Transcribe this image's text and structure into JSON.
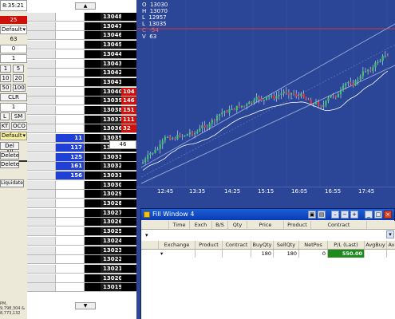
{
  "left_panel": {
    "clock": "8:35:21",
    "badge_value": "25",
    "default_select_1": "Default",
    "qty_label": "63",
    "field_a": "0",
    "field_b": "1",
    "qty_buttons": [
      "1",
      "5",
      "10",
      "20",
      "50",
      "100"
    ],
    "clr_label": "CLR",
    "field_c": "1",
    "lm_buttons": [
      "L",
      "SM"
    ],
    "kt_buttons": [
      "KT",
      "OCO"
    ],
    "default_select_2": "Default",
    "del_all_label": "Del All",
    "delete_label_1": "Delete",
    "delete_label_2": "Delete",
    "liquidate_label": "Liquidate",
    "footnote_line1": "PM, 9,798,304 &",
    "footnote_line2": "8,773,132"
  },
  "ladder": {
    "scroll_up": "▲",
    "scroll_down": "▼",
    "position_value": "46",
    "rows": [
      {
        "price": "13048",
        "bid": "",
        "ask": ""
      },
      {
        "price": "13047",
        "bid": "",
        "ask": ""
      },
      {
        "price": "13046",
        "bid": "",
        "ask": ""
      },
      {
        "price": "13045",
        "bid": "",
        "ask": ""
      },
      {
        "price": "13044",
        "bid": "",
        "ask": ""
      },
      {
        "price": "13043",
        "bid": "",
        "ask": ""
      },
      {
        "price": "13042",
        "bid": "",
        "ask": ""
      },
      {
        "price": "13041",
        "bid": "",
        "ask": ""
      },
      {
        "price": "13040",
        "bid": "",
        "ask": "104"
      },
      {
        "price": "13039",
        "bid": "",
        "ask": "146"
      },
      {
        "price": "13038",
        "bid": "",
        "ask": "151"
      },
      {
        "price": "13037",
        "bid": "",
        "ask": "111"
      },
      {
        "price": "13036",
        "bid": "",
        "ask": "32"
      },
      {
        "price": "13035",
        "bid": "11",
        "ask": ""
      },
      {
        "price": "13034",
        "bid": "117",
        "ask": ""
      },
      {
        "price": "13033",
        "bid": "125",
        "ask": ""
      },
      {
        "price": "13032",
        "bid": "161",
        "ask": ""
      },
      {
        "price": "13031",
        "bid": "156",
        "ask": ""
      },
      {
        "price": "13030",
        "bid": "",
        "ask": ""
      },
      {
        "price": "13029",
        "bid": "",
        "ask": ""
      },
      {
        "price": "13028",
        "bid": "",
        "ask": ""
      },
      {
        "price": "13027",
        "bid": "",
        "ask": ""
      },
      {
        "price": "13026",
        "bid": "",
        "ask": ""
      },
      {
        "price": "13025",
        "bid": "",
        "ask": ""
      },
      {
        "price": "13024",
        "bid": "",
        "ask": ""
      },
      {
        "price": "13023",
        "bid": "",
        "ask": ""
      },
      {
        "price": "13022",
        "bid": "",
        "ask": ""
      },
      {
        "price": "13021",
        "bid": "",
        "ask": ""
      },
      {
        "price": "13020",
        "bid": "",
        "ask": ""
      },
      {
        "price": "13019",
        "bid": "",
        "ask": ""
      }
    ]
  },
  "chart": {
    "ohlc": {
      "o_label": "O",
      "o": "13030",
      "h_label": "H",
      "h": "13070",
      "l_label": "L",
      "l": "12957",
      "last_label": "L",
      "last": "13035",
      "c_label": "C",
      "c": "-54",
      "v_label": "V",
      "v": "63"
    },
    "time_labels": [
      "12:45",
      "13:35",
      "14:25",
      "15:15",
      "16:05",
      "16:55",
      "17:45"
    ],
    "colors": {
      "background": "#2b4696",
      "up_candle": "#3fc46b",
      "down_candle": "#e23a3a",
      "price_line": "#d23a3a"
    }
  },
  "fill_window": {
    "title": "Fill Window 4",
    "top_headers": [
      "Time",
      "Exch",
      "B/S",
      "Qty",
      "Price",
      "Product",
      "Contract"
    ],
    "bottom_headers": [
      "Exchange",
      "Product",
      "Contract",
      "BuyQty",
      "SellQty",
      "NetPos",
      "P/L (Last)",
      "AvgBuy",
      "Av"
    ],
    "summary": {
      "buy_qty": "180",
      "sell_qty": "180",
      "net_pos": "0",
      "pl_last": "550.00"
    }
  }
}
